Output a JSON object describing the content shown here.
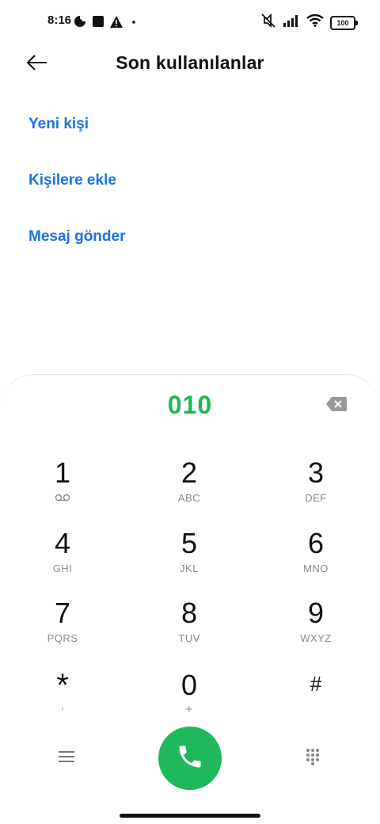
{
  "status_bar": {
    "time": "8:16",
    "battery": "100",
    "icons": [
      "data-saver-icon",
      "square-notification-icon",
      "warning-icon",
      "dot-icon",
      "mute-icon",
      "signal-icon",
      "wifi-icon",
      "battery-icon"
    ]
  },
  "header": {
    "title": "Son kullanılanlar",
    "back_icon": "back-arrow-icon"
  },
  "actions": [
    {
      "label": "Yeni kişi"
    },
    {
      "label": "Kişilere ekle"
    },
    {
      "label": "Mesaj gönder"
    }
  ],
  "dialer": {
    "number": "010",
    "keys": [
      {
        "digit": "1",
        "letters": "",
        "sub_icon": "voicemail-icon"
      },
      {
        "digit": "2",
        "letters": "ABC"
      },
      {
        "digit": "3",
        "letters": "DEF"
      },
      {
        "digit": "4",
        "letters": "GHI"
      },
      {
        "digit": "5",
        "letters": "JKL"
      },
      {
        "digit": "6",
        "letters": "MNO"
      },
      {
        "digit": "7",
        "letters": "PQRS"
      },
      {
        "digit": "8",
        "letters": "TUV"
      },
      {
        "digit": "9",
        "letters": "WXYZ"
      },
      {
        "digit": "*",
        "letters": ","
      },
      {
        "digit": "0",
        "letters": "+"
      },
      {
        "digit": "#",
        "letters": ""
      }
    ],
    "accent_color": "#1db954",
    "link_color": "#1a73e8"
  }
}
